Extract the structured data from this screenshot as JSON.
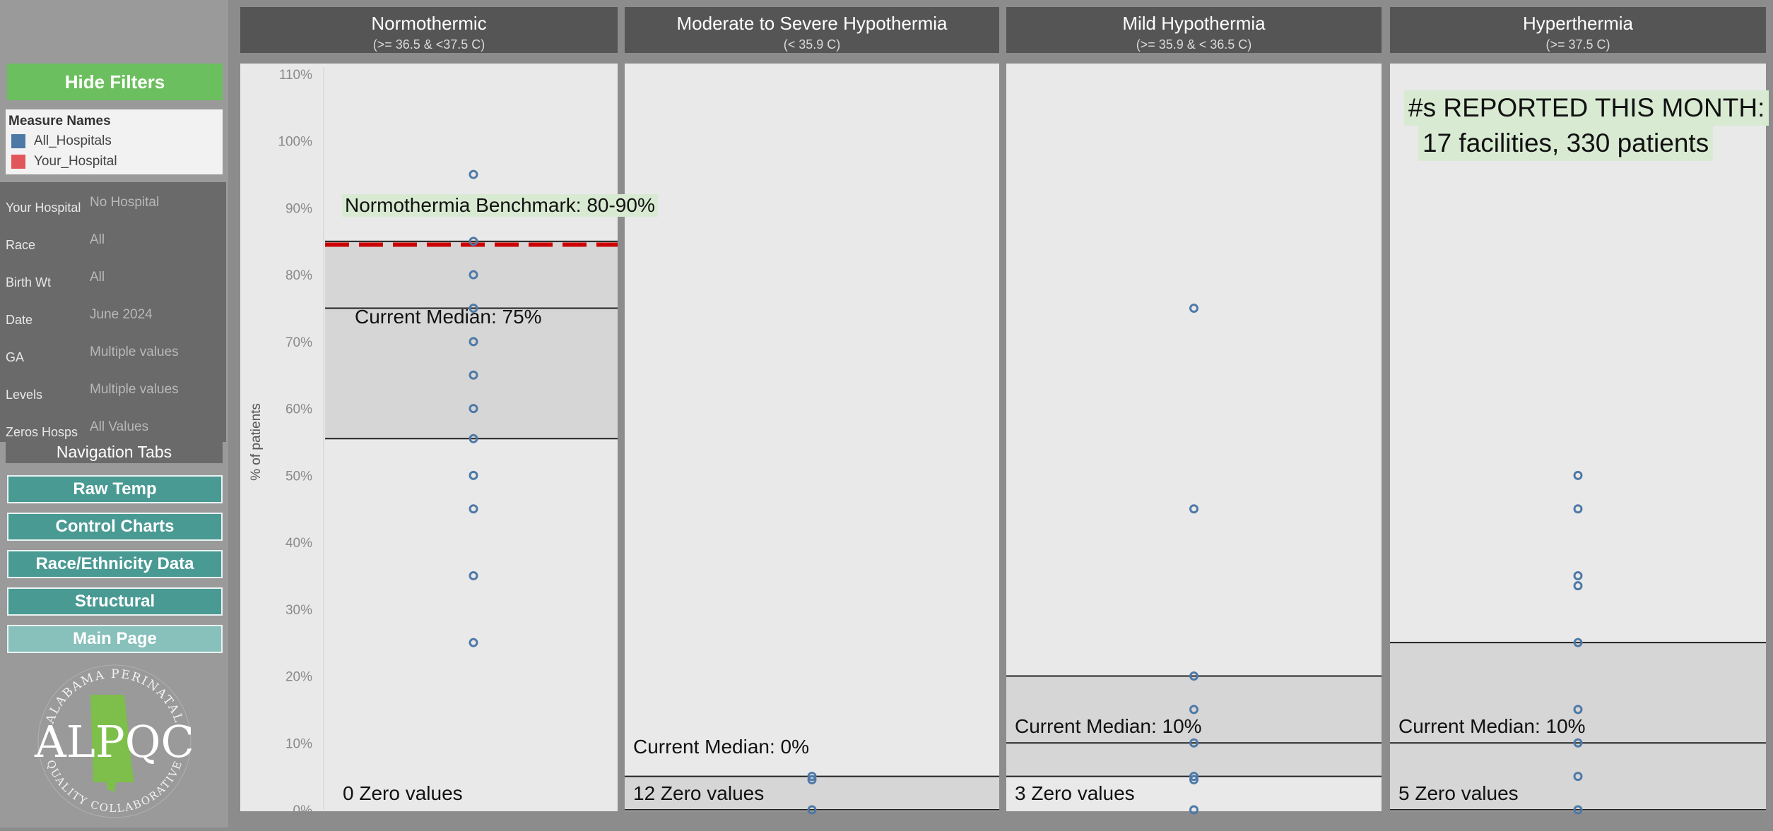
{
  "sidebar": {
    "hide_filters_label": "Hide Filters",
    "legend": {
      "title": "Measure Names",
      "items": [
        {
          "label": "All_Hospitals",
          "color": "#4e79a7"
        },
        {
          "label": "Your_Hospital",
          "color": "#e15759"
        }
      ]
    },
    "filters": [
      {
        "label": "Your Hospital",
        "value": "No Hospital"
      },
      {
        "label": "Race",
        "value": "All"
      },
      {
        "label": "Birth Wt",
        "value": "All"
      },
      {
        "label": "Date",
        "value": "June 2024"
      },
      {
        "label": "GA",
        "value": "Multiple values"
      },
      {
        "label": "Levels",
        "value": "Multiple values"
      },
      {
        "label": "Zeros Hosps",
        "value": "All Values"
      }
    ],
    "nav_title": "Navigation Tabs",
    "nav_buttons": [
      "Raw Temp",
      "Control Charts",
      "Race/Ethnicity Data",
      "Structural",
      "Main Page"
    ],
    "logo": {
      "main_text": "ALPQC",
      "ring_top": "ALABAMA PERINATAL",
      "ring_bottom": "QUALITY COLLABORATIVE",
      "state_color": "#7dbf4a"
    }
  },
  "chart_data": {
    "type": "scatter",
    "ylabel": "% of patients",
    "ylim": [
      0,
      110
    ],
    "yticks": [
      "0%",
      "10%",
      "20%",
      "30%",
      "40%",
      "50%",
      "60%",
      "70%",
      "80%",
      "90%",
      "100%",
      "110%"
    ],
    "point_color": "#4e79a7",
    "panels": [
      {
        "title": "Normothermic",
        "subtitle": "(>= 36.5 & <37.5 C)",
        "values": [
          95,
          85,
          80,
          75,
          70,
          65,
          60,
          55.5,
          50,
          45,
          35,
          25
        ],
        "band": [
          55.5,
          85
        ],
        "median": 75,
        "median_label": "Current Median: 75%",
        "benchmark": 84.5,
        "benchmark_label": "Normothermia Benchmark: 80-90%",
        "zero_label": "0 Zero values"
      },
      {
        "title": "Moderate to Severe Hypothermia",
        "subtitle": "(< 35.9 C)",
        "values": [
          5,
          4.5,
          0
        ],
        "band": [
          0,
          5
        ],
        "median": 0,
        "median_label": "Current Median: 0%",
        "zero_label": "12 Zero values"
      },
      {
        "title": "Mild Hypothermia",
        "subtitle": "(>= 35.9 & < 36.5 C)",
        "values": [
          75,
          45,
          20,
          15,
          10,
          5,
          4.5,
          0
        ],
        "band": [
          5,
          20
        ],
        "median": 10,
        "median_label": "Current Median: 10%",
        "zero_label": "3 Zero values"
      },
      {
        "title": "Hyperthermia",
        "subtitle": "(>= 37.5 C)",
        "values": [
          50,
          45,
          35,
          33.5,
          25,
          15,
          10,
          5,
          0
        ],
        "band": [
          0,
          25
        ],
        "median": 10,
        "median_label": "Current Median: 10%",
        "zero_label": "5 Zero values",
        "note": [
          "#s REPORTED THIS MONTH:",
          "17 facilities, 330 patients"
        ]
      }
    ],
    "benchmark_color": "#cc0000",
    "band_color": "#d6d6d6",
    "label_highlight": "#d9ead3"
  }
}
